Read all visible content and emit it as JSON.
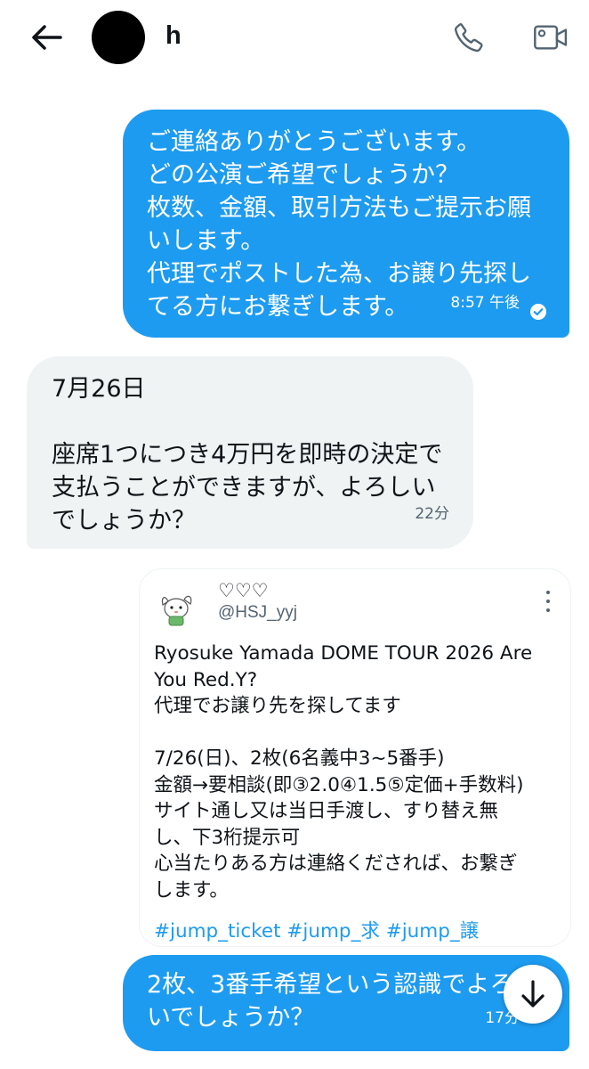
{
  "header": {
    "back_icon": "arrow-left-icon",
    "contact_name": "h",
    "call_icon": "phone-icon",
    "video_icon": "video-camera-icon"
  },
  "messages": [
    {
      "direction": "outgoing",
      "text": "ご連絡ありがとうございます。\nどの公演ご希望でしょうか？\n枚数、金額、取引方法もご提示お願\nいします。\n代理でポストした為、お譲り先探し\nてる方にお繋ぎします。",
      "time": "8:57 午後",
      "status_icon": "check-circle-icon"
    },
    {
      "direction": "incoming",
      "text": "7月26日\n\n座席1つにつき4万円を即時の決定で\n支払うことができますが、よろしい\nでしょうか？",
      "time": "22分"
    },
    {
      "direction": "outgoing",
      "text": "2枚、3番手希望という認識でよろし\nいでしょうか？",
      "time": "17分"
    }
  ],
  "tweet": {
    "author_name": "♡♡♡",
    "handle": "@HSJ_yyj",
    "more_icon": "more-vertical-icon",
    "lines": [
      "Ryosuke Yamada DOME TOUR 2026 Are",
      "You Red.Y?",
      "代理でお譲り先を探してます",
      " ",
      "7/26(日)、2枚(6名義中3~5番手)",
      "金額→要相談(即③2.0④1.5⑤定価+手数料)",
      "サイト通し又は当日手渡し、すり替え無",
      "し、下3桁提示可",
      "心当たりある方は連絡くだされば、お繋ぎ",
      "します。"
    ],
    "hashtags": [
      "#jump_ticket",
      "#jump_求",
      "#jump_譲"
    ]
  },
  "scroll_fab": {
    "icon": "arrow-down-icon"
  },
  "colors": {
    "accent": "#1d9bf0",
    "incoming_bubble": "#eff3f4",
    "text_primary": "#0f1419",
    "text_secondary": "#536471"
  }
}
